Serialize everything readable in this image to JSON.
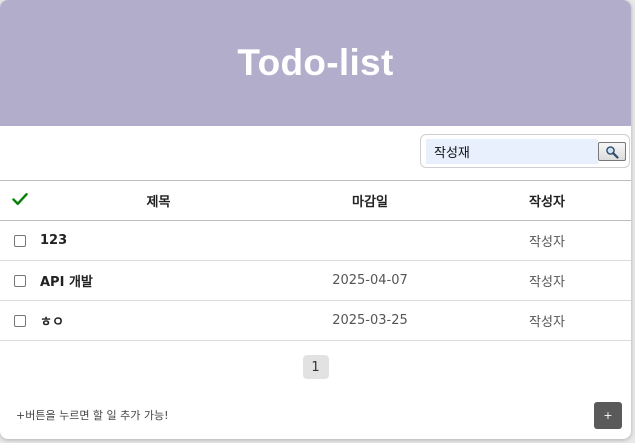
{
  "header": {
    "title": "Todo-list"
  },
  "search": {
    "value": "작성재",
    "icon": "magnifier-icon"
  },
  "table": {
    "check_all_icon": "green-checkmark-icon",
    "columns": {
      "title": "제목",
      "due": "마감일",
      "author": "작성자"
    },
    "rows": [
      {
        "checked": false,
        "title": "123",
        "due": "",
        "author": "작성자"
      },
      {
        "checked": false,
        "title": "API 개발",
        "due": "2025-04-07",
        "author": "작성자"
      },
      {
        "checked": false,
        "title": "ㅎㅇ",
        "due": "2025-03-25",
        "author": "작성자"
      }
    ]
  },
  "pagination": {
    "current_page": "1"
  },
  "footer": {
    "hint": "+버튼을 누르면 할 일 추가 가능!",
    "add_label": "+"
  },
  "colors": {
    "header_bg": "#b1adcb",
    "check_green": "#1a9a1a",
    "add_button_bg": "#5a5a5a"
  }
}
